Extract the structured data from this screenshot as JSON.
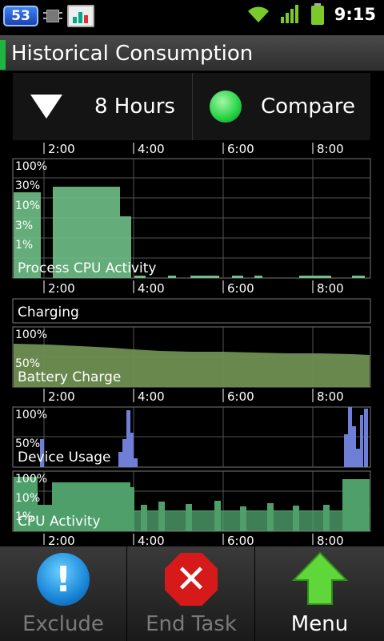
{
  "status_bar": {
    "notification_count": "53",
    "time": "9:15",
    "icons": [
      "chip-icon",
      "app-icon",
      "wifi-icon",
      "signal-icon",
      "battery-icon"
    ]
  },
  "title": "Historical Consumption",
  "controls": {
    "hours_label": "8 Hours",
    "compare_label": "Compare"
  },
  "time_ticks": [
    "2:00",
    "4:00",
    "6:00",
    "8:00"
  ],
  "panels": {
    "process_cpu": {
      "label": "Process CPU Activity",
      "y_labels": [
        "100%",
        "30%",
        "10%",
        "3%",
        "1%"
      ],
      "color": "#6fbf86"
    },
    "charging": {
      "label": "Charging"
    },
    "battery": {
      "label": "Battery Charge",
      "y_labels": [
        "100%",
        "50%"
      ],
      "color": "#6f8f52"
    },
    "device_usage": {
      "label": "Device Usage",
      "y_labels": [
        "100%",
        "50%"
      ],
      "color": "#6f7fd8"
    },
    "cpu_activity": {
      "label": "CPU Activity",
      "y_labels": [
        "100%",
        "10%",
        "1%"
      ],
      "color": "#4f9f6a"
    }
  },
  "bottom_bar": {
    "exclude_label": "Exclude",
    "end_task_label": "End Task",
    "menu_label": "Menu"
  },
  "colors": {
    "accent_green": "#1fb541",
    "disabled_text": "#7a7a7a"
  }
}
